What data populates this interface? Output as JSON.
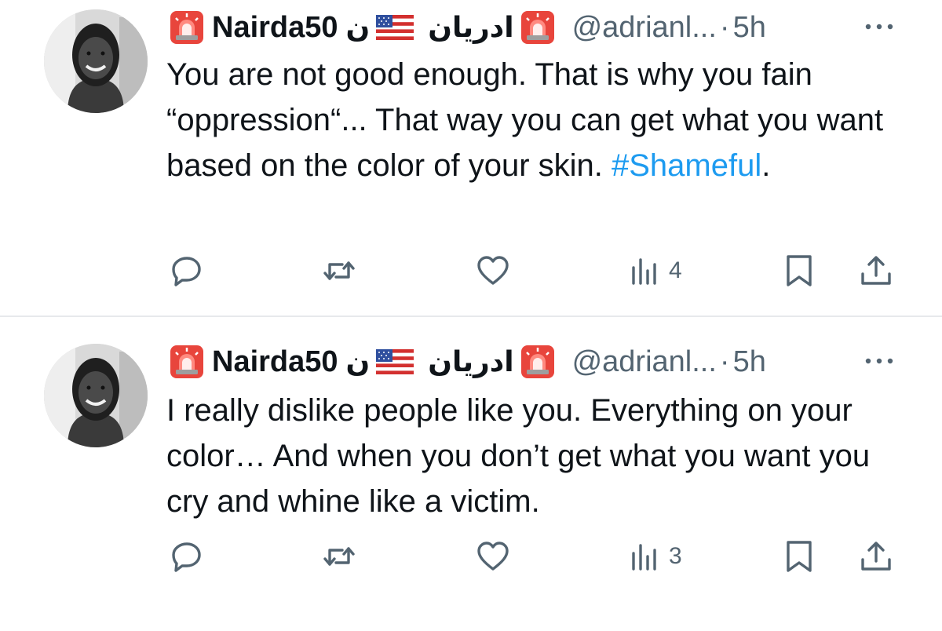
{
  "tweets": [
    {
      "display_name": "Nairda50",
      "rtl_name": "ادریان",
      "rtl_letter": "ن",
      "handle": "@adrianl...",
      "separator": "·",
      "time": "5h",
      "text_plain": "You are not good enough. That is why you fain “oppression“... That way you can get what you want based on the color of your skin. ",
      "hashtag": "#Shameful",
      "text_end": ".",
      "views": "4"
    },
    {
      "display_name": "Nairda50",
      "rtl_name": "ادریان",
      "rtl_letter": "ن",
      "handle": "@adrianl...",
      "separator": "·",
      "time": "5h",
      "text_plain": "I really dislike people like you. Everything on your color… And when you don’t get what you want you cry and whine like a victim.",
      "hashtag": "",
      "text_end": "",
      "views": "3"
    }
  ],
  "icons": {
    "siren": "siren-emoji-icon",
    "flag": "us-flag-icon",
    "more": "more-options-icon",
    "reply": "reply-icon",
    "retweet": "retweet-icon",
    "like": "like-heart-icon",
    "views": "views-chart-icon",
    "bookmark": "bookmark-icon",
    "share": "share-icon"
  },
  "colors": {
    "text": "#0f1419",
    "secondary": "#536471",
    "link": "#1d9bf0",
    "divider": "#e7e9ec"
  }
}
